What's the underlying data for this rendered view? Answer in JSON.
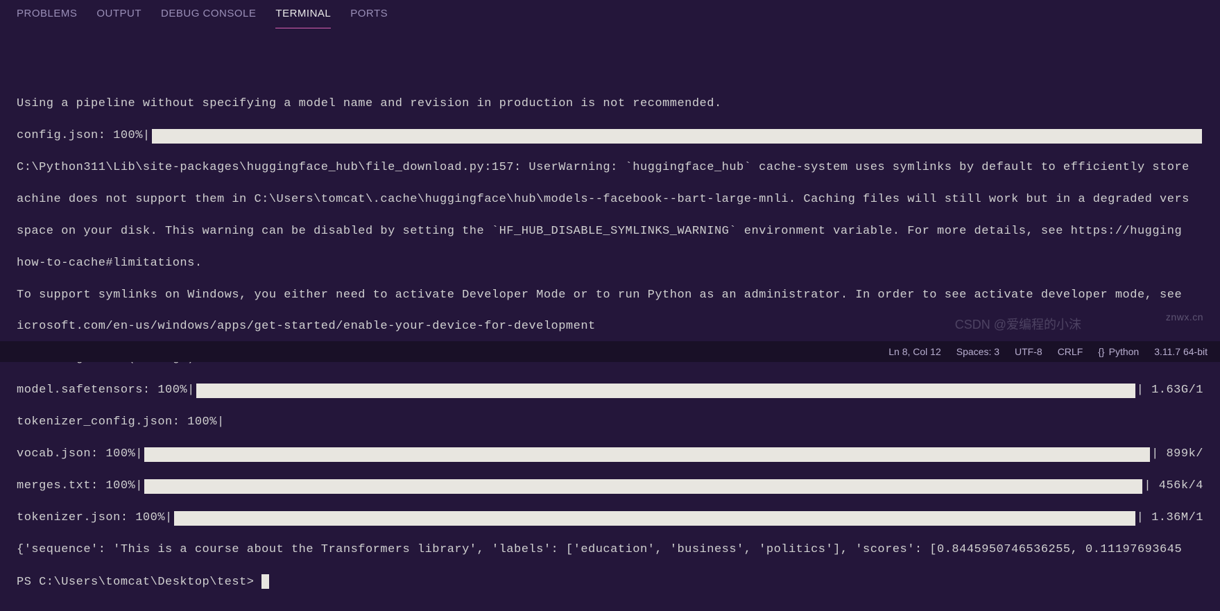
{
  "tabs": {
    "items": [
      "PROBLEMS",
      "OUTPUT",
      "DEBUG CONSOLE",
      "TERMINAL",
      "PORTS"
    ],
    "active_index": 3
  },
  "terminal": {
    "blank1": "",
    "line1": "Using a pipeline without specifying a model name and revision in production is not recommended.",
    "bar1_label": "config.json: 100%|",
    "bar1_trail": "",
    "line2": "C:\\Python311\\Lib\\site-packages\\huggingface_hub\\file_download.py:157: UserWarning: `huggingface_hub` cache-system uses symlinks by default to efficiently store",
    "line3": "achine does not support them in C:\\Users\\tomcat\\.cache\\huggingface\\hub\\models--facebook--bart-large-mnli. Caching files will still work but in a degraded vers",
    "line4": "space on your disk. This warning can be disabled by setting the `HF_HUB_DISABLE_SYMLINKS_WARNING` environment variable. For more details, see https://hugging",
    "line5": "how-to-cache#limitations.",
    "line6": "To support symlinks on Windows, you either need to activate Developer Mode or to run Python as an administrator. In order to see activate developer mode, see",
    "line7": "icrosoft.com/en-us/windows/apps/get-started/enable-your-device-for-development",
    "line8": "  warnings.warn(message)",
    "bar2_label": "model.safetensors: 100%|",
    "bar2_trail": "| 1.63G/1",
    "bar3_label": "tokenizer_config.json: 100%|",
    "bar3_trail": "",
    "bar4_label": "vocab.json: 100%|",
    "bar4_trail": "| 899k/",
    "bar5_label": "merges.txt: 100%|",
    "bar5_trail": "| 456k/4",
    "bar6_label": "tokenizer.json: 100%|",
    "bar6_trail": "| 1.36M/1",
    "result": "{'sequence': 'This is a course about the Transformers library', 'labels': ['education', 'business', 'politics'], 'scores': [0.8445950746536255, 0.11197693645",
    "prompt": "PS C:\\Users\\tomcat\\Desktop\\test> "
  },
  "watermark": "CSDN @爱编程的小沫",
  "wm2": "znwx.cn",
  "status": {
    "pos": "Ln 8, Col 12",
    "spaces": "Spaces: 3",
    "enc": "UTF-8",
    "eol": "CRLF",
    "lang": "Python",
    "interp": "3.11.7 64-bit"
  }
}
